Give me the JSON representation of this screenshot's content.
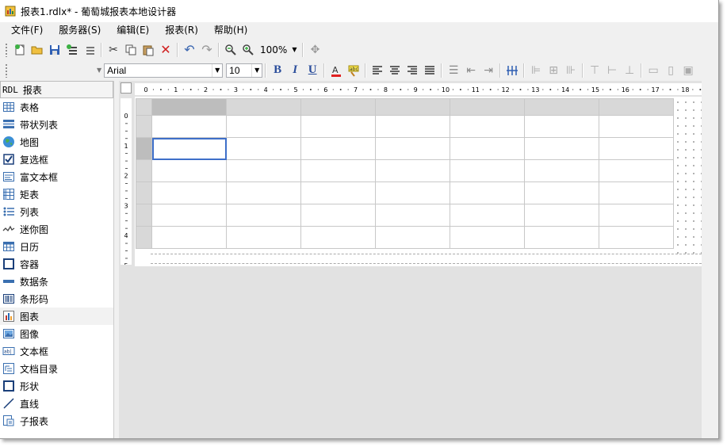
{
  "window": {
    "title": "报表1.rdlx* - 葡萄城报表本地设计器"
  },
  "menu": [
    "文件(F)",
    "服务器(S)",
    "编辑(E)",
    "报表(R)",
    "帮助(H)"
  ],
  "toolbar1": {
    "icons": [
      "new-icon",
      "open-icon",
      "save-icon",
      "add-item-icon",
      "remove-item-icon",
      "cut-icon",
      "copy-icon",
      "paste-icon",
      "delete-icon",
      "undo-icon",
      "redo-icon",
      "zoom-out-icon",
      "zoom-in-icon",
      "pan-icon"
    ],
    "zoom": "100%"
  },
  "toolbar2": {
    "font_family": "Arial",
    "font_size": "10",
    "bold": "B",
    "italic": "I",
    "underline": "U"
  },
  "panel": {
    "prefix": "RDL",
    "title": "报表"
  },
  "tools": [
    {
      "label": "表格",
      "icon": "table-icon"
    },
    {
      "label": "带状列表",
      "icon": "banded-list-icon"
    },
    {
      "label": "地图",
      "icon": "globe-icon"
    },
    {
      "label": "复选框",
      "icon": "checkbox-icon"
    },
    {
      "label": "富文本框",
      "icon": "richtext-icon"
    },
    {
      "label": "矩表",
      "icon": "matrix-icon"
    },
    {
      "label": "列表",
      "icon": "list-icon"
    },
    {
      "label": "迷你图",
      "icon": "sparkline-icon"
    },
    {
      "label": "日历",
      "icon": "calendar-icon"
    },
    {
      "label": "容器",
      "icon": "container-icon"
    },
    {
      "label": "数据条",
      "icon": "databar-icon"
    },
    {
      "label": "条形码",
      "icon": "barcode-icon"
    },
    {
      "label": "图表",
      "icon": "chart-icon"
    },
    {
      "label": "图像",
      "icon": "image-icon"
    },
    {
      "label": "文本框",
      "icon": "textbox-icon"
    },
    {
      "label": "文档目录",
      "icon": "toc-icon"
    },
    {
      "label": "形状",
      "icon": "shape-icon"
    },
    {
      "label": "直线",
      "icon": "line-icon"
    },
    {
      "label": "子报表",
      "icon": "subreport-icon"
    }
  ],
  "selected_tool": "图表",
  "ruler_h": [
    "0",
    "1",
    "2",
    "3",
    "4",
    "5",
    "6",
    "7",
    "8",
    "9",
    "10",
    "11",
    "12",
    "13",
    "14",
    "15",
    "16",
    "17",
    "18"
  ],
  "ruler_v": [
    "0",
    "1",
    "2",
    "3",
    "4",
    "5"
  ],
  "table": {
    "rows": 6,
    "cols": 7,
    "active_cell": [
      1,
      0
    ]
  }
}
